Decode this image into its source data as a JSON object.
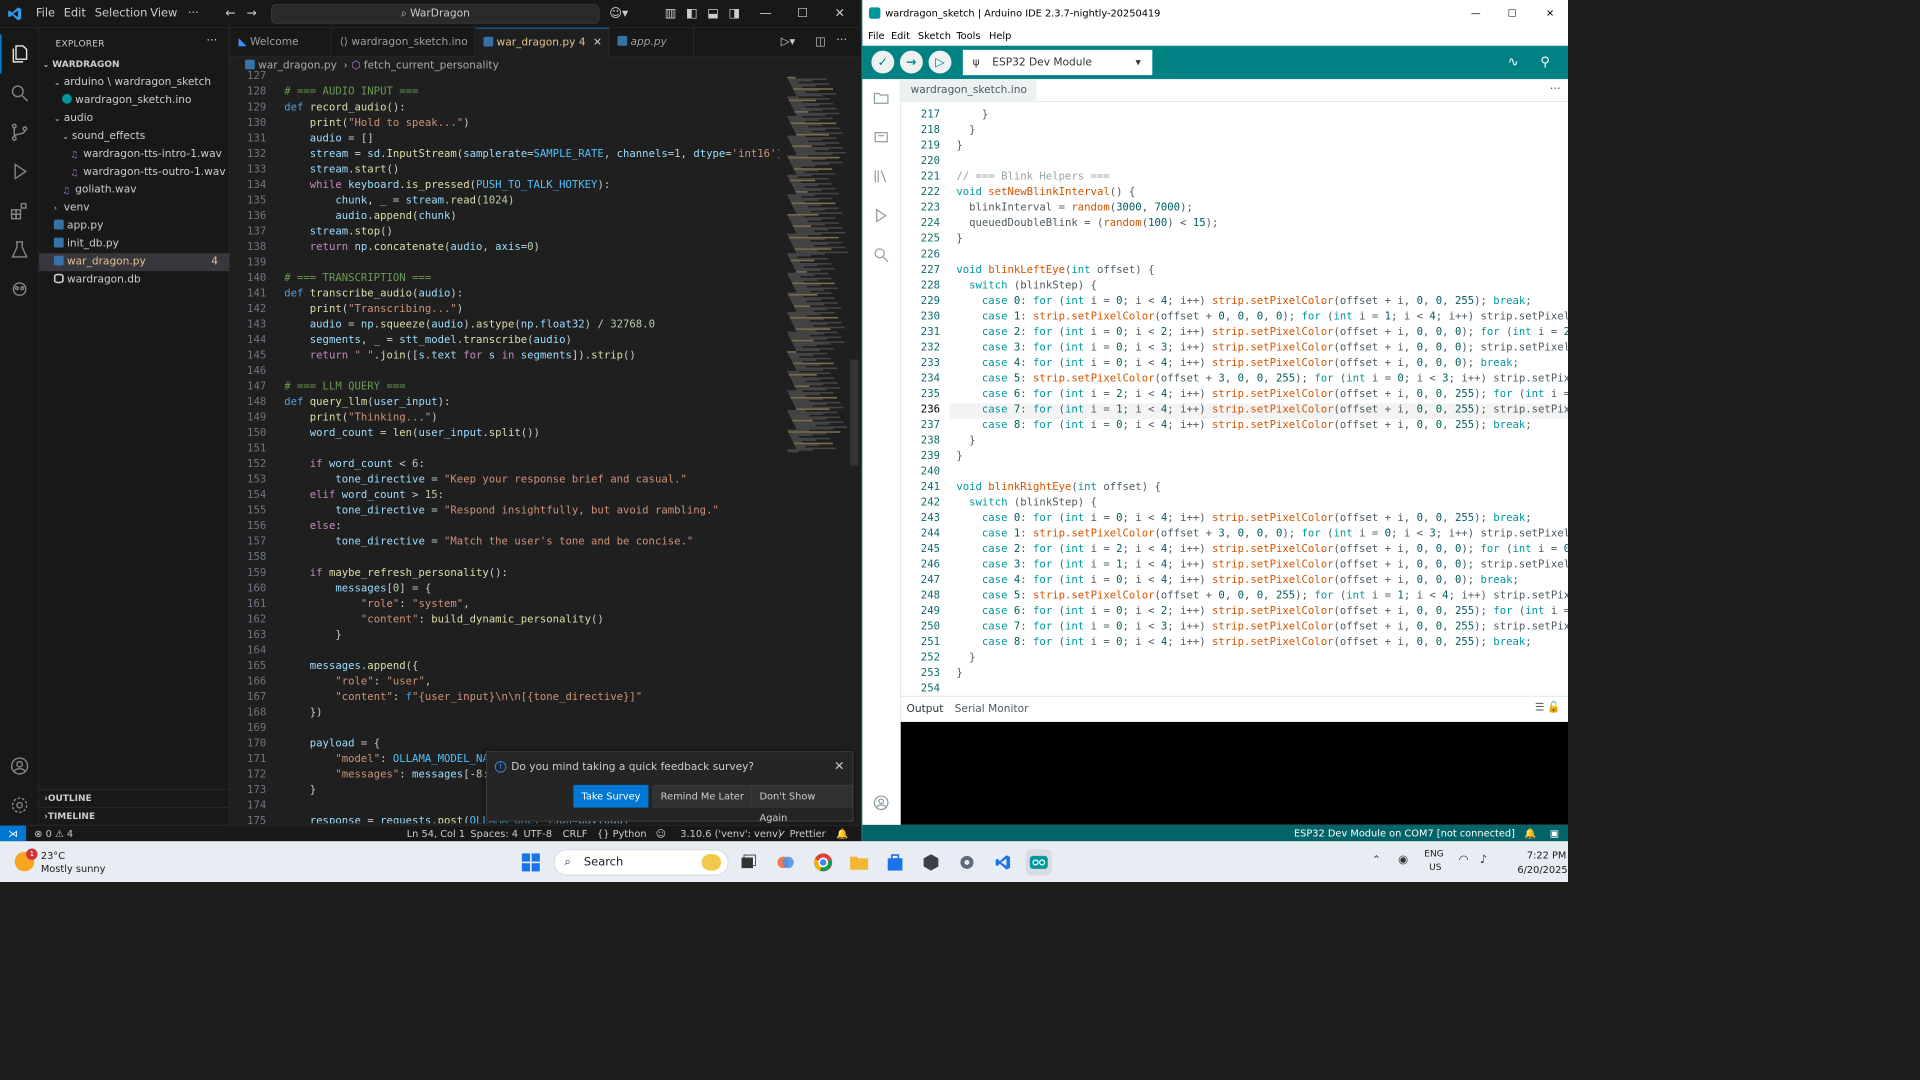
{
  "vscode": {
    "menu": [
      "File",
      "Edit",
      "Selection",
      "View",
      "···"
    ],
    "search": "WarDragon",
    "explorer": {
      "header": "EXPLORER",
      "root": "WARDRAGON",
      "items": [
        {
          "label": "arduino \\ wardragon_sketch",
          "depth": 1,
          "type": "folder-open"
        },
        {
          "label": "wardragon_sketch.ino",
          "depth": 2,
          "type": "ino"
        },
        {
          "label": "audio",
          "depth": 1,
          "type": "folder-open"
        },
        {
          "label": "sound_effects",
          "depth": 2,
          "type": "folder-open"
        },
        {
          "label": "wardragon-tts-intro-1.wav",
          "depth": 3,
          "type": "wav"
        },
        {
          "label": "wardragon-tts-outro-1.wav",
          "depth": 3,
          "type": "wav"
        },
        {
          "label": "goliath.wav",
          "depth": 2,
          "type": "wav"
        },
        {
          "label": "venv",
          "depth": 1,
          "type": "folder"
        },
        {
          "label": "app.py",
          "depth": 1,
          "type": "py"
        },
        {
          "label": "init_db.py",
          "depth": 1,
          "type": "py"
        },
        {
          "label": "war_dragon.py",
          "depth": 1,
          "type": "py",
          "badge": "4",
          "selected": true
        },
        {
          "label": "wardragon.db",
          "depth": 1,
          "type": "db"
        }
      ],
      "outline": "OUTLINE",
      "timeline": "TIMELINE"
    },
    "tabs": [
      {
        "label": "Welcome"
      },
      {
        "label": "wardragon_sketch.ino"
      },
      {
        "label": "war_dragon.py 4",
        "active": true
      },
      {
        "label": "app.py"
      }
    ],
    "breadcrumb": {
      "file": "war_dragon.py",
      "symbol": "fetch_current_personality"
    },
    "code_lines": [
      {
        "n": "127",
        "t": ""
      },
      {
        "n": "128",
        "t": "# === AUDIO INPUT ==="
      },
      {
        "n": "129",
        "t": "def record_audio():"
      },
      {
        "n": "130",
        "t": "    print(\"Hold to speak...\")"
      },
      {
        "n": "131",
        "t": "    audio = []"
      },
      {
        "n": "132",
        "t": "    stream = sd.InputStream(samplerate=SAMPLE_RATE, channels=1, dtype='int16')"
      },
      {
        "n": "133",
        "t": "    stream.start()"
      },
      {
        "n": "134",
        "t": "    while keyboard.is_pressed(PUSH_TO_TALK_HOTKEY):"
      },
      {
        "n": "135",
        "t": "        chunk, _ = stream.read(1024)"
      },
      {
        "n": "136",
        "t": "        audio.append(chunk)"
      },
      {
        "n": "137",
        "t": "    stream.stop()"
      },
      {
        "n": "138",
        "t": "    return np.concatenate(audio, axis=0)"
      },
      {
        "n": "139",
        "t": ""
      },
      {
        "n": "140",
        "t": "# === TRANSCRIPTION ==="
      },
      {
        "n": "141",
        "t": "def transcribe_audio(audio):"
      },
      {
        "n": "142",
        "t": "    print(\"Transcribing...\")"
      },
      {
        "n": "143",
        "t": "    audio = np.squeeze(audio).astype(np.float32) / 32768.0"
      },
      {
        "n": "144",
        "t": "    segments, _ = stt_model.transcribe(audio)"
      },
      {
        "n": "145",
        "t": "    return \" \".join([s.text for s in segments]).strip()"
      },
      {
        "n": "146",
        "t": ""
      },
      {
        "n": "147",
        "t": "# === LLM QUERY ==="
      },
      {
        "n": "148",
        "t": "def query_llm(user_input):"
      },
      {
        "n": "149",
        "t": "    print(\"Thinking...\")"
      },
      {
        "n": "150",
        "t": "    word_count = len(user_input.split())"
      },
      {
        "n": "151",
        "t": ""
      },
      {
        "n": "152",
        "t": "    if word_count < 6:"
      },
      {
        "n": "153",
        "t": "        tone_directive = \"Keep your response brief and casual.\""
      },
      {
        "n": "154",
        "t": "    elif word_count > 15:"
      },
      {
        "n": "155",
        "t": "        tone_directive = \"Respond insightfully, but avoid rambling.\""
      },
      {
        "n": "156",
        "t": "    else:"
      },
      {
        "n": "157",
        "t": "        tone_directive = \"Match the user's tone and be concise.\""
      },
      {
        "n": "158",
        "t": ""
      },
      {
        "n": "159",
        "t": "    if maybe_refresh_personality():"
      },
      {
        "n": "160",
        "t": "        messages[0] = {"
      },
      {
        "n": "161",
        "t": "            \"role\": \"system\","
      },
      {
        "n": "162",
        "t": "            \"content\": build_dynamic_personality()"
      },
      {
        "n": "163",
        "t": "        }"
      },
      {
        "n": "164",
        "t": ""
      },
      {
        "n": "165",
        "t": "    messages.append({"
      },
      {
        "n": "166",
        "t": "        \"role\": \"user\","
      },
      {
        "n": "167",
        "t": "        \"content\": f\"{user_input}\\n\\n[{tone_directive}]\""
      },
      {
        "n": "168",
        "t": "    })"
      },
      {
        "n": "169",
        "t": ""
      },
      {
        "n": "170",
        "t": "    payload = {"
      },
      {
        "n": "171",
        "t": "        \"model\": OLLAMA_MODEL_NA"
      },
      {
        "n": "172",
        "t": "        \"messages\": messages[-8:"
      },
      {
        "n": "173",
        "t": "    }"
      },
      {
        "n": "174",
        "t": ""
      },
      {
        "n": "175",
        "t": "    response = requests.post(OLLAMA_URL, json=payload)"
      }
    ],
    "survey": {
      "question": "Do you mind taking a quick feedback survey?",
      "take": "Take Survey",
      "remind": "Remind Me Later",
      "dont": "Don't Show Again"
    },
    "status": {
      "problems": "⊗ 0 ⚠ 4",
      "position": "Ln 54, Col 1",
      "spaces": "Spaces: 4",
      "encoding": "UTF-8",
      "eol": "CRLF",
      "language": "{} Python",
      "interpreter": "3.10.6 ('venv': venv)",
      "prettier": "✓ Prettier"
    }
  },
  "arduino": {
    "title": "wardragon_sketch | Arduino IDE 2.3.7-nightly-20250419",
    "menu": [
      "File",
      "Edit",
      "Sketch",
      "Tools",
      "Help"
    ],
    "board": "ESP32 Dev Module",
    "tab": "wardragon_sketch.ino",
    "code_lines": [
      {
        "n": "217",
        "t": "    }"
      },
      {
        "n": "218",
        "t": "  }"
      },
      {
        "n": "219",
        "t": "}"
      },
      {
        "n": "220",
        "t": ""
      },
      {
        "n": "221",
        "t": "// === Blink Helpers ==="
      },
      {
        "n": "222",
        "t": "void setNewBlinkInterval() {"
      },
      {
        "n": "223",
        "t": "  blinkInterval = random(3000, 7000);"
      },
      {
        "n": "224",
        "t": "  queuedDoubleBlink = (random(100) < 15);"
      },
      {
        "n": "225",
        "t": "}"
      },
      {
        "n": "226",
        "t": ""
      },
      {
        "n": "227",
        "t": "void blinkLeftEye(int offset) {"
      },
      {
        "n": "228",
        "t": "  switch (blinkStep) {"
      },
      {
        "n": "229",
        "t": "    case 0: for (int i = 0; i < 4; i++) strip.setPixelColor(offset + i, 0, 0, 255); break;"
      },
      {
        "n": "230",
        "t": "    case 1: strip.setPixelColor(offset + 0, 0, 0, 0); for (int i = 1; i < 4; i++) strip.setPixelCo"
      },
      {
        "n": "231",
        "t": "    case 2: for (int i = 0; i < 2; i++) strip.setPixelColor(offset + i, 0, 0, 0); for (int i = 2;"
      },
      {
        "n": "232",
        "t": "    case 3: for (int i = 0; i < 3; i++) strip.setPixelColor(offset + i, 0, 0, 0); strip.setPixelC"
      },
      {
        "n": "233",
        "t": "    case 4: for (int i = 0; i < 4; i++) strip.setPixelColor(offset + i, 0, 0, 0); break;"
      },
      {
        "n": "234",
        "t": "    case 5: strip.setPixelColor(offset + 3, 0, 0, 255); for (int i = 0; i < 3; i++) strip.setPixe"
      },
      {
        "n": "235",
        "t": "    case 6: for (int i = 2; i < 4; i++) strip.setPixelColor(offset + i, 0, 0, 255); for (int i ="
      },
      {
        "n": "236",
        "t": "    case 7: for (int i = 1; i < 4; i++) strip.setPixelColor(offset + i, 0, 0, 255); strip.setPixe"
      },
      {
        "n": "237",
        "t": "    case 8: for (int i = 0; i < 4; i++) strip.setPixelColor(offset + i, 0, 0, 255); break;"
      },
      {
        "n": "238",
        "t": "  }"
      },
      {
        "n": "239",
        "t": "}"
      },
      {
        "n": "240",
        "t": ""
      },
      {
        "n": "241",
        "t": "void blinkRightEye(int offset) {"
      },
      {
        "n": "242",
        "t": "  switch (blinkStep) {"
      },
      {
        "n": "243",
        "t": "    case 0: for (int i = 0; i < 4; i++) strip.setPixelColor(offset + i, 0, 0, 255); break;"
      },
      {
        "n": "244",
        "t": "    case 1: strip.setPixelColor(offset + 3, 0, 0, 0); for (int i = 0; i < 3; i++) strip.setPixelC"
      },
      {
        "n": "245",
        "t": "    case 2: for (int i = 2; i < 4; i++) strip.setPixelColor(offset + i, 0, 0, 0); for (int i = 0;"
      },
      {
        "n": "246",
        "t": "    case 3: for (int i = 1; i < 4; i++) strip.setPixelColor(offset + i, 0, 0, 0); strip.setPixelC"
      },
      {
        "n": "247",
        "t": "    case 4: for (int i = 0; i < 4; i++) strip.setPixelColor(offset + i, 0, 0, 0); break;"
      },
      {
        "n": "248",
        "t": "    case 5: strip.setPixelColor(offset + 0, 0, 0, 255); for (int i = 1; i < 4; i++) strip.setPixelC"
      },
      {
        "n": "249",
        "t": "    case 6: for (int i = 0; i < 2; i++) strip.setPixelColor(offset + i, 0, 0, 255); for (int i ="
      },
      {
        "n": "250",
        "t": "    case 7: for (int i = 0; i < 3; i++) strip.setPixelColor(offset + i, 0, 0, 255); strip.setPix"
      },
      {
        "n": "251",
        "t": "    case 8: for (int i = 0; i < 4; i++) strip.setPixelColor(offset + i, 0, 0, 255); break;"
      },
      {
        "n": "252",
        "t": "  }"
      },
      {
        "n": "253",
        "t": "}"
      },
      {
        "n": "254",
        "t": ""
      }
    ],
    "output_tab": "Output",
    "serial_tab": "Serial Monitor",
    "status": "ESP32 Dev Module on COM7 [not connected]"
  },
  "taskbar": {
    "weather_temp": "23°C",
    "weather_desc": "Mostly sunny",
    "weather_badge": "1",
    "search": "Search",
    "lang1": "ENG",
    "lang2": "US",
    "time": "7:22 PM",
    "date": "6/20/2025"
  },
  "colors": {
    "vscode_accent": "#0078d4",
    "arduino_teal": "#008184",
    "arduino_status": "#006468"
  }
}
